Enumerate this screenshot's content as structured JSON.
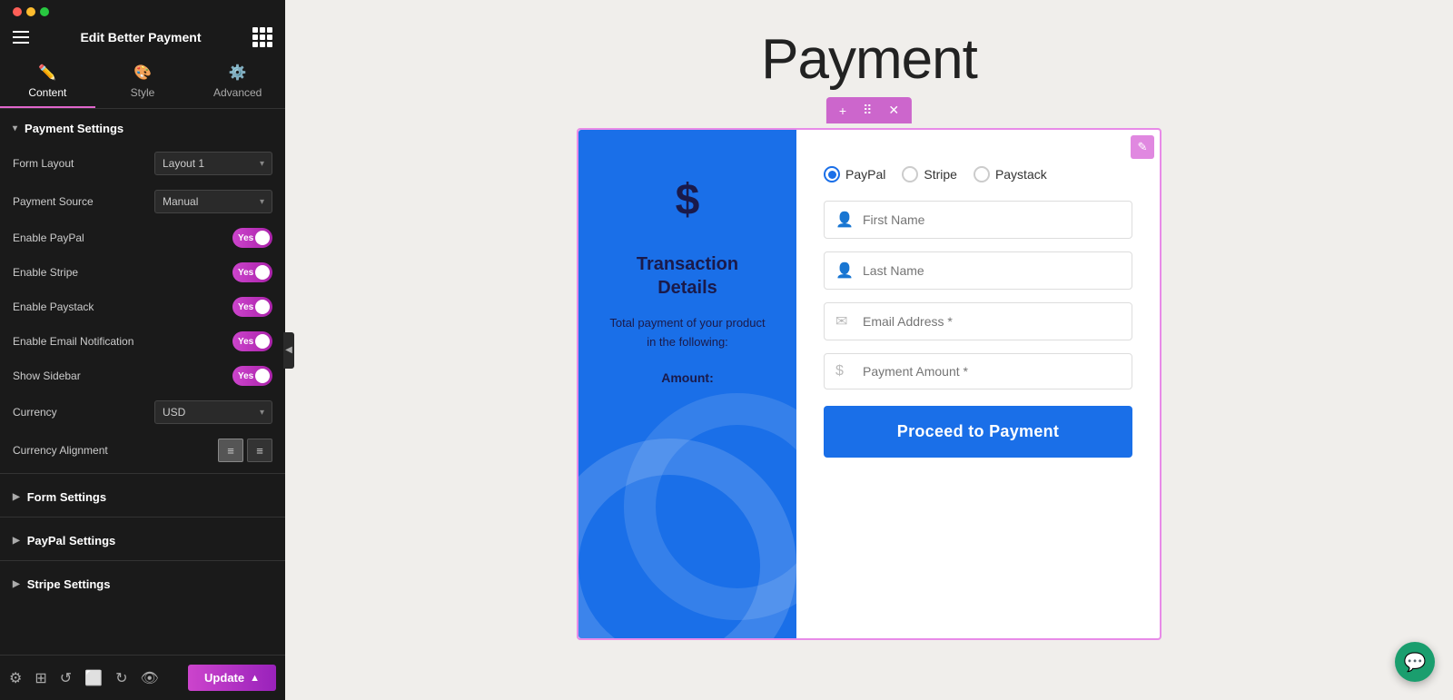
{
  "panel": {
    "dots": [
      "red",
      "yellow",
      "green"
    ],
    "title": "Edit Better Payment",
    "tabs": [
      {
        "id": "content",
        "label": "Content",
        "icon": "✏️",
        "active": true
      },
      {
        "id": "style",
        "label": "Style",
        "icon": "🎨",
        "active": false
      },
      {
        "id": "advanced",
        "label": "Advanced",
        "icon": "⚙️",
        "active": false
      }
    ],
    "sections": {
      "payment_settings": {
        "label": "Payment Settings",
        "expanded": true,
        "rows": [
          {
            "label": "Form Layout",
            "type": "dropdown",
            "value": "Layout 1"
          },
          {
            "label": "Payment Source",
            "type": "dropdown",
            "value": "Manual"
          },
          {
            "label": "Enable PayPal",
            "type": "toggle",
            "value": "Yes"
          },
          {
            "label": "Enable Stripe",
            "type": "toggle",
            "value": "Yes"
          },
          {
            "label": "Enable Paystack",
            "type": "toggle",
            "value": "Yes"
          },
          {
            "label": "Enable Email Notification",
            "type": "toggle",
            "value": "Yes"
          },
          {
            "label": "Show Sidebar",
            "type": "toggle",
            "value": "Yes"
          },
          {
            "label": "Currency",
            "type": "dropdown",
            "value": "USD"
          },
          {
            "label": "Currency Alignment",
            "type": "align",
            "value": "left"
          }
        ]
      },
      "form_settings": {
        "label": "Form Settings",
        "expanded": false
      },
      "paypal_settings": {
        "label": "PayPal Settings",
        "expanded": false
      },
      "stripe_settings": {
        "label": "Stripe Settings",
        "expanded": false
      }
    },
    "toolbar": {
      "update_label": "Update",
      "icons": [
        "settings",
        "layers",
        "history",
        "responsive",
        "loop",
        "eye"
      ]
    }
  },
  "main": {
    "page_title": "Payment",
    "widget_toolbar": {
      "add_btn": "+",
      "drag_btn": "⠿",
      "close_btn": "✕"
    },
    "widget_sidebar": {
      "dollar_sign": "$",
      "title": "Transaction Details",
      "description": "Total payment of your product in the following:",
      "amount_label": "Amount:"
    },
    "widget_form": {
      "payment_options": [
        {
          "label": "PayPal",
          "selected": true
        },
        {
          "label": "Stripe",
          "selected": false
        },
        {
          "label": "Paystack",
          "selected": false
        }
      ],
      "fields": [
        {
          "placeholder": "First Name",
          "icon": "person"
        },
        {
          "placeholder": "Last Name",
          "icon": "person"
        },
        {
          "placeholder": "Email Address *",
          "icon": "envelope"
        },
        {
          "placeholder": "Payment Amount *",
          "icon": "dollar"
        }
      ],
      "submit_button": "Proceed to Payment"
    }
  }
}
